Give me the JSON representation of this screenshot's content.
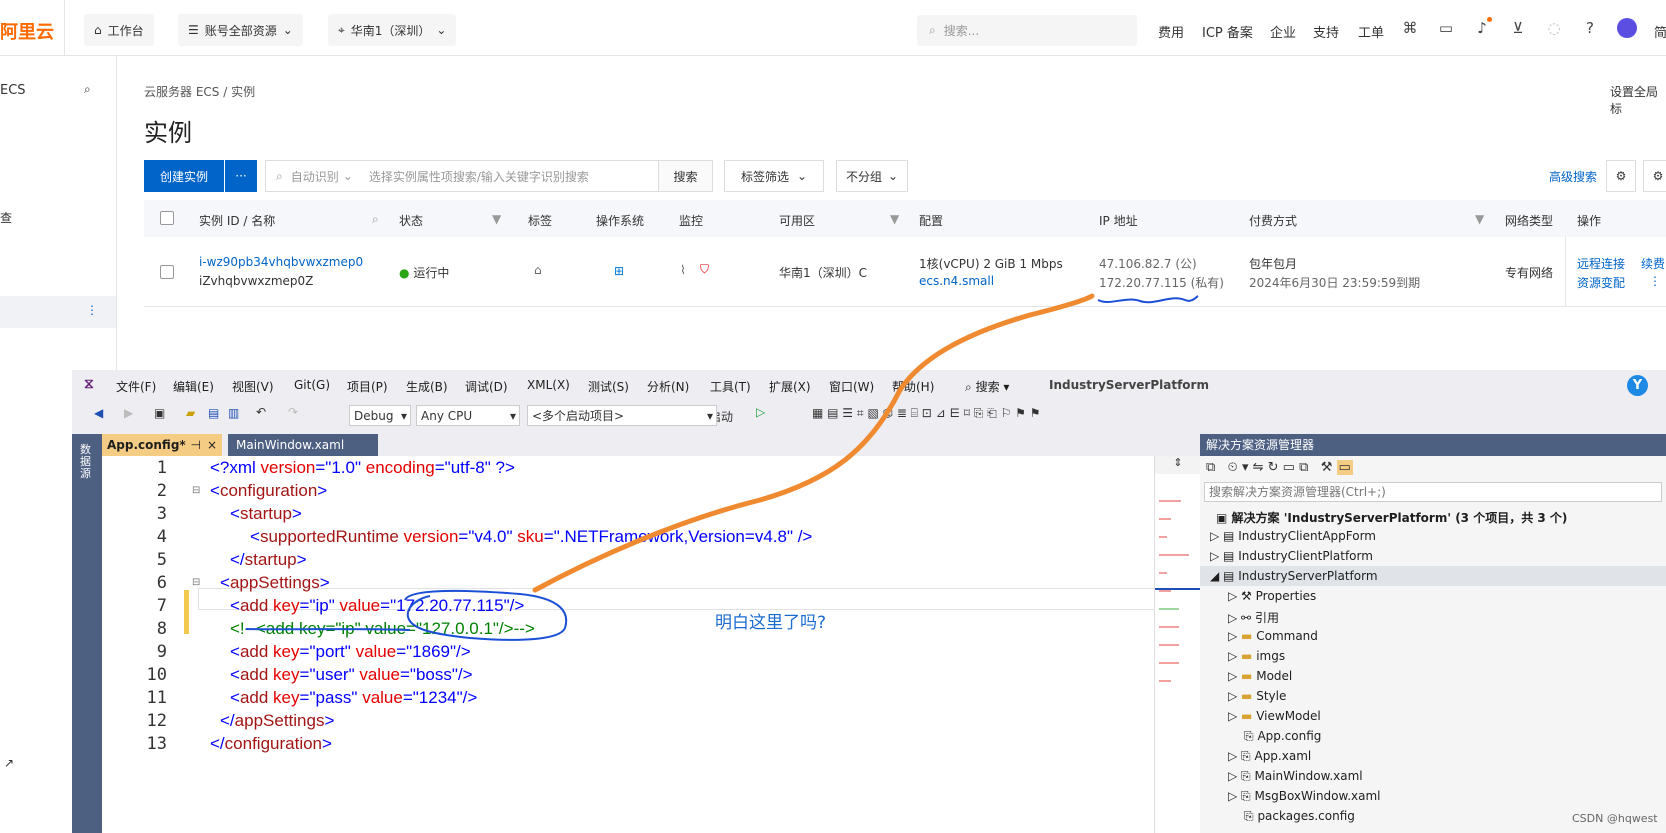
{
  "topbar": {
    "logo": "阿里云",
    "workbench": "工作台",
    "resources": "账号全部资源",
    "region": "华南1（深圳）",
    "search_placeholder": "搜索...",
    "links": [
      "费用",
      "ICP 备案",
      "企业",
      "支持",
      "工单"
    ],
    "edge_text": "简"
  },
  "sidebar": {
    "title": "ECS",
    "item": "查"
  },
  "main": {
    "breadcrumb": "云服务器 ECS  /  实例",
    "title": "实例",
    "settings_link": "设置全局标",
    "create_label": "创建实例",
    "more_label": "···",
    "filter_mode": "自动识别",
    "filter_placeholder": "选择实例属性项搜索/输入关键字识别搜索",
    "search_label": "搜索",
    "tag_filter": "标签筛选",
    "group_filter": "不分组",
    "adv_search": "高级搜索",
    "columns": [
      "实例 ID / 名称",
      "状态",
      "标签",
      "操作系统",
      "监控",
      "可用区",
      "配置",
      "IP 地址",
      "付费方式",
      "网络类型",
      "操作"
    ],
    "row": {
      "id": "i-wz90pb34vhqbvwxzmep0",
      "name": "iZvhqbvwxzmep0Z",
      "status": "运行中",
      "zone": "华南1（深圳）C",
      "config": "1核(vCPU)  2 GiB  1 Mbps",
      "spec": "ecs.n4.small",
      "public_ip": "47.106.82.7 (公)",
      "private_ip": "172.20.77.115 (私有)",
      "pay": "包年包月",
      "expire": "2024年6月30日 23:59:59到期",
      "network": "专有网络",
      "op1": "远程连接",
      "op2": "资源变配",
      "op3": "续费"
    }
  },
  "vs": {
    "menus": [
      "文件(F)",
      "编辑(E)",
      "视图(V)",
      "Git(G)",
      "项目(P)",
      "生成(B)",
      "调试(D)",
      "XML(X)",
      "测试(S)",
      "分析(N)",
      "工具(T)",
      "扩展(X)",
      "窗口(W)",
      "帮助(H)"
    ],
    "search": "搜索",
    "project": "IndustryServerPlatform",
    "avatar": "Y",
    "config_combo": "Debug",
    "cpu_combo": "Any CPU",
    "startup_combo": "<多个启动项目>",
    "start_label": "启动",
    "tab_active": "App.config*",
    "tab_2": "MainWindow.xaml",
    "left_strip": "数据源",
    "line_numbers": [
      "1",
      "2",
      "3",
      "4",
      "5",
      "6",
      "7",
      "8",
      "9",
      "10",
      "11",
      "12",
      "13"
    ],
    "code": {
      "l1a": "<?xml ",
      "l1b": "version",
      "l1c": "=\"",
      "l1d": "1.0",
      "l1e": "\" ",
      "l1f": "encoding",
      "l1g": "=\"",
      "l1h": "utf-8",
      "l1i": "\" ?>",
      "l2": "configuration",
      "l3": "startup",
      "l4a": "supportedRuntime",
      "l4b": "version",
      "l4c": "v4.0",
      "l4d": "sku",
      "l4e": ".NETFramework,Version=v4.8",
      "l5": "startup",
      "l6": "appSettings",
      "add": "add",
      "key": "key",
      "value": "value",
      "l7k": "ip",
      "l7v": "172.20.77.115",
      "l8": "<!--<add key=\"ip\" value=\"127.0.0.1\"/>-->",
      "l9k": "port",
      "l9v": "1869",
      "l10k": "user",
      "l10v": "boss",
      "l11k": "pass",
      "l11v": "1234",
      "l12": "appSettings",
      "l13": "configuration"
    },
    "solution": {
      "title": "解决方案资源管理器",
      "search": "搜索解决方案资源管理器(Ctrl+;)",
      "root": "解决方案 'IndustryServerPlatform' (3 个项目，共 3 个)",
      "items": [
        "IndustryClientAppForm",
        "IndustryClientPlatform",
        "IndustryServerPlatform",
        "Properties",
        "引用",
        "Command",
        "imgs",
        "Model",
        "Style",
        "ViewModel",
        "App.config",
        "App.xaml",
        "MainWindow.xaml",
        "MsgBoxWindow.xaml",
        "packages.config"
      ]
    }
  },
  "annotation": "明白这里了吗?",
  "watermark": "CSDN @hqwest",
  "colors": {
    "brand": "#ff6a00",
    "primary": "#0064c8",
    "vs_tab_active": "#f5cc84",
    "orange_stroke": "#f08a30",
    "blue_stroke": "#1a4fd6"
  }
}
